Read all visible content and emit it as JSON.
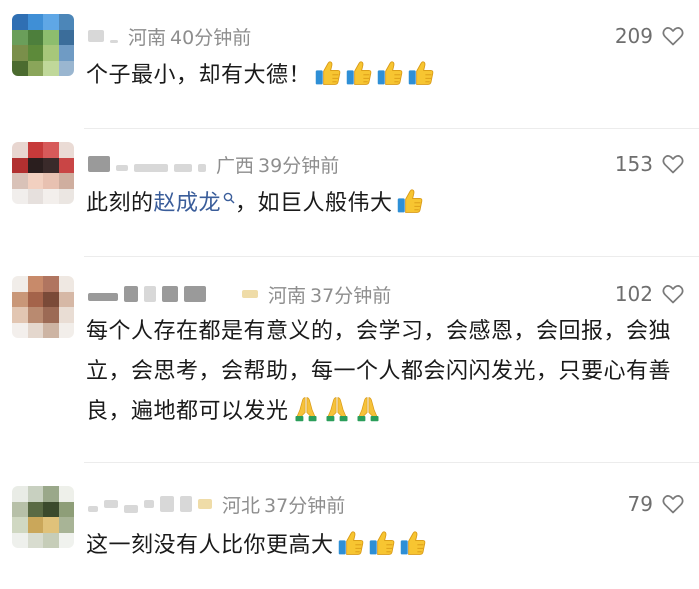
{
  "comments": [
    {
      "location": "河南",
      "time": "40分钟前",
      "likes": "209",
      "text": "个子最小，却有大德！",
      "emoji": "thumbs-up",
      "emoji_count": 4
    },
    {
      "location": "广西",
      "time": "39分钟前",
      "likes": "153",
      "text_before": "此刻的",
      "link_text": "赵成龙",
      "text_after": "，如巨人般伟大",
      "emoji": "thumbs-up",
      "emoji_count": 1
    },
    {
      "location": "河南",
      "time": "37分钟前",
      "likes": "102",
      "text": "每个人存在都是有意义的，会学习，会感恩，会回报，会独立，会思考，会帮助，每一个人都会闪闪发光，只要心有善良，遍地都可以发光",
      "emoji": "folded-hands",
      "emoji_count": 3
    },
    {
      "location": "河北",
      "time": "37分钟前",
      "likes": "79",
      "text": "这一刻没有人比你更高大",
      "emoji": "thumbs-up",
      "emoji_count": 3
    }
  ],
  "colors": {
    "link": "#3a5d9a",
    "meta": "#8e8e8e",
    "like_count": "#6e6e6e"
  }
}
